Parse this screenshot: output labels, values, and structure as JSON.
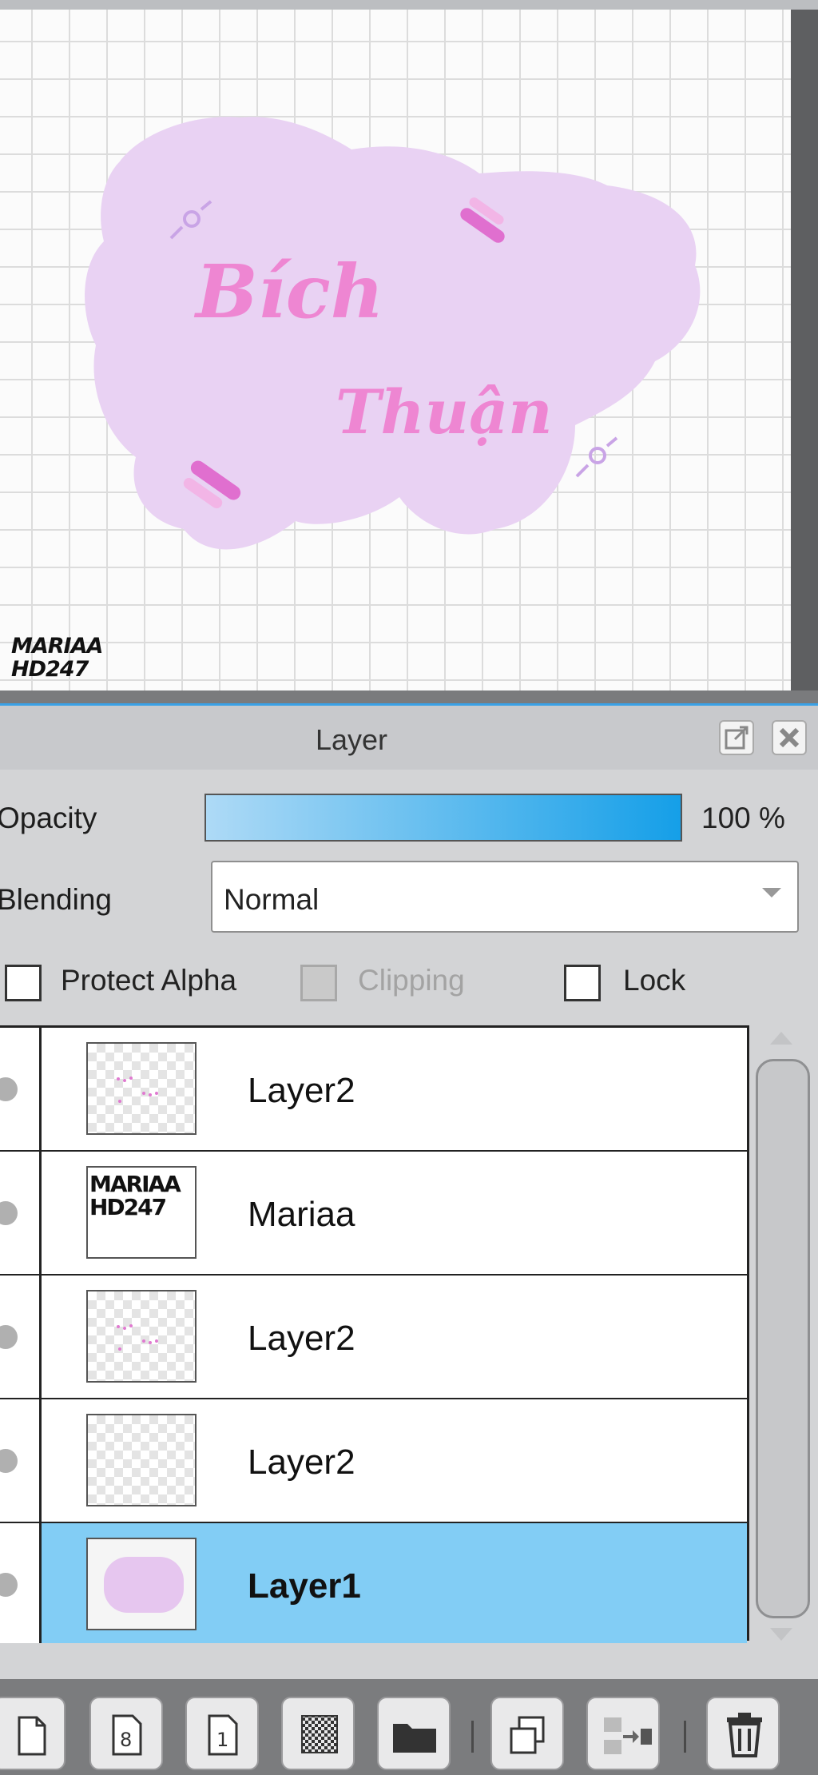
{
  "canvas": {
    "artwork_text": [
      "Bích",
      "Thuận"
    ],
    "watermark": [
      "MARIAA",
      "HD247"
    ]
  },
  "panel": {
    "title": "Layer",
    "opacity": {
      "label": "Opacity",
      "value": "100 %",
      "level": 1.0
    },
    "blending": {
      "label": "Blending",
      "value": "Normal"
    },
    "options": {
      "protect_alpha": {
        "label": "Protect Alpha",
        "checked": false
      },
      "clipping": {
        "label": "Clipping",
        "checked": false,
        "disabled": true
      },
      "lock": {
        "label": "Lock",
        "checked": false
      }
    }
  },
  "layers": [
    {
      "name": "Layer2",
      "selected": false,
      "thumbnail": "text-art"
    },
    {
      "name": "Mariaa",
      "selected": false,
      "thumbnail": "watermark",
      "thumb_text": [
        "MARIAA",
        "HD247"
      ]
    },
    {
      "name": "Layer2",
      "selected": false,
      "thumbnail": "text-art"
    },
    {
      "name": "Layer2",
      "selected": false,
      "thumbnail": "empty"
    },
    {
      "name": "Layer1",
      "selected": true,
      "thumbnail": "pink-cloud"
    }
  ],
  "toolbar": {
    "buttons": [
      "new-layer-icon",
      "new-8bit-layer-icon",
      "new-1bit-layer-icon",
      "new-halftone-layer-icon",
      "new-folder-icon",
      "duplicate-layer-icon",
      "merge-down-icon",
      "delete-layer-icon"
    ]
  },
  "colors": {
    "accent": "#3aa1e6",
    "selected_row": "#82cdf5",
    "opacity_fill": "#159fe8",
    "artwork_pink": "#ee86d2",
    "cloud": "#e9d2f3"
  }
}
